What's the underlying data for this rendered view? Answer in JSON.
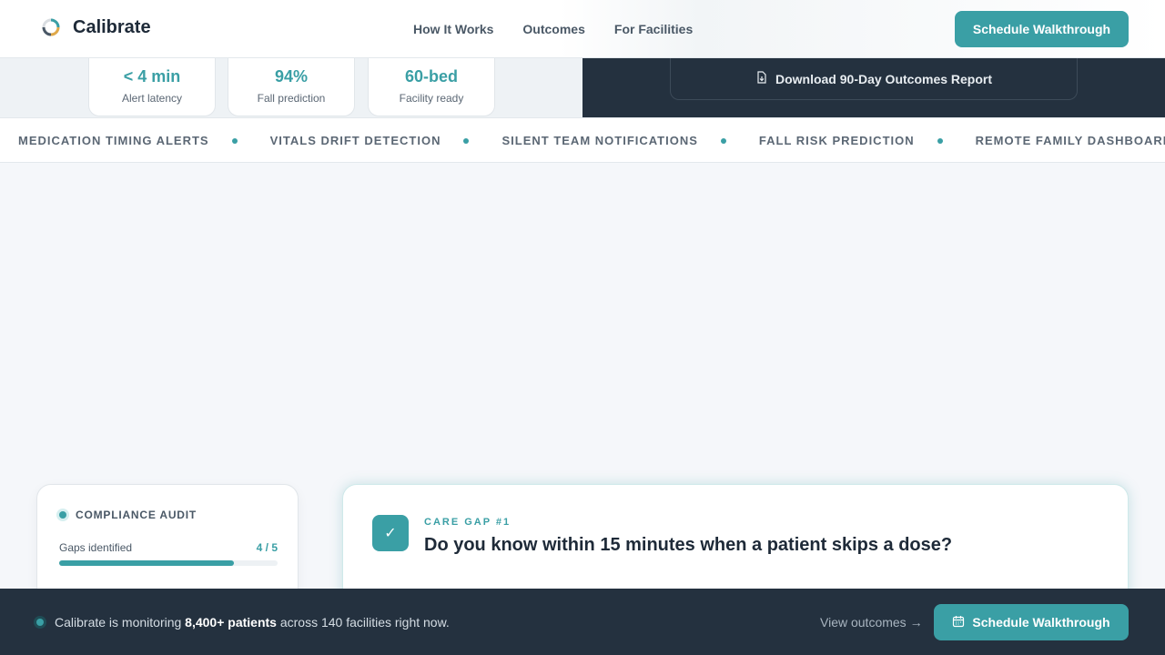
{
  "header": {
    "brand": "Calibrate",
    "nav": [
      "How It Works",
      "Outcomes",
      "For Facilities"
    ],
    "cta": "Schedule Walkthrough"
  },
  "stats": [
    {
      "value": "< 4 min",
      "label": "Alert latency"
    },
    {
      "value": "94%",
      "label": "Fall prediction"
    },
    {
      "value": "60-bed",
      "label": "Facility ready"
    }
  ],
  "download": {
    "label": "Download 90-Day Outcomes Report",
    "icon": "file-download-icon"
  },
  "ticker": [
    "MEDICATION TIMING ALERTS",
    "VITALS DRIFT DETECTION",
    "SILENT TEAM NOTIFICATIONS",
    "FALL RISK PREDICTION",
    "REMOTE FAMILY DASHBOARD"
  ],
  "audit": {
    "title": "COMPLIANCE AUDIT",
    "row_label": "Gaps identified",
    "count": "4 / 5",
    "progress": 0.8
  },
  "care_gap": {
    "kicker": "CARE GAP #1",
    "question": "Do you know within 15 minutes when a patient skips a dose?"
  },
  "bottom_bar": {
    "text_before": "Calibrate is monitoring ",
    "text_bold": "8,400+ patients",
    "text_after": " across 140 facilities right now.",
    "link": "View outcomes →",
    "cta": "Schedule Walkthrough"
  },
  "colors": {
    "accent": "#3a9fa5",
    "dark": "#24313f"
  }
}
